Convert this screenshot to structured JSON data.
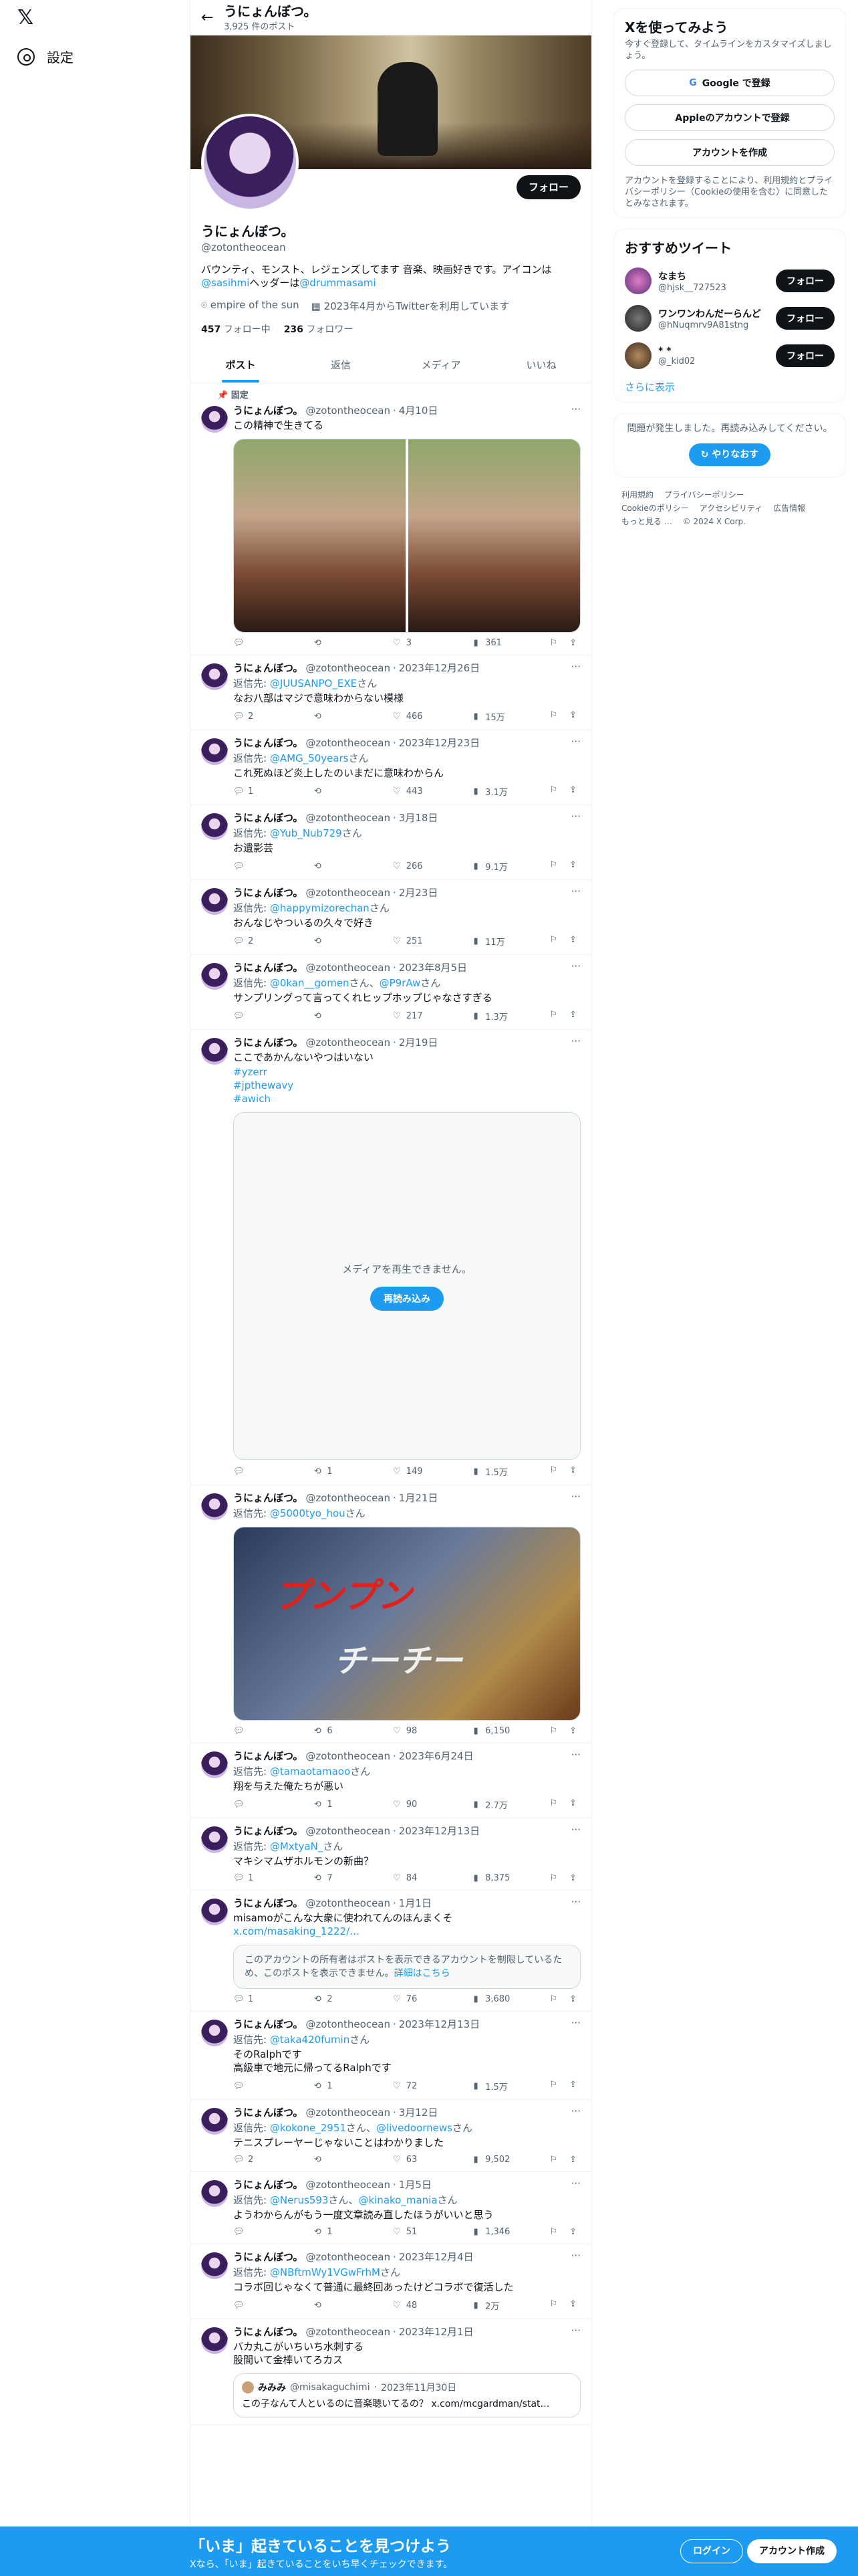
{
  "nav": {
    "settings_label": "設定"
  },
  "header": {
    "title": "うにょんぼつ。",
    "post_count": "3,925 件のポスト"
  },
  "profile": {
    "follow_label": "フォロー",
    "name": "うにょんぼつ。",
    "handle": "@zotontheocean",
    "bio_text": "バウンティ、モンスト、レジェンズしてます 音楽、映画好きです。アイコンは",
    "bio_mention1": "@sasihmi",
    "bio_mid": "ヘッダーは",
    "bio_mention2": "@drummasami",
    "location": "empire of the sun",
    "joined": "2023年4月からTwitterを利用しています",
    "following_count": "457",
    "following_label": "フォロー中",
    "followers_count": "236",
    "followers_label": "フォロワー"
  },
  "tabs": [
    "ポスト",
    "返信",
    "メディア",
    "いいね"
  ],
  "pinned_label": "固定",
  "tweets": [
    {
      "name": "うにょんぼつ。",
      "handle": "@zotontheocean",
      "date": "4月10日",
      "text": "この精神で生きてる",
      "replies": "",
      "retweets": "",
      "likes": "3",
      "views": "361"
    },
    {
      "name": "うにょんぼつ。",
      "handle": "@zotontheocean",
      "date": "2023年12月26日",
      "reply_to": "@JUUSANPO_EXE",
      "text": "なお八部はマジで意味わからない模様",
      "replies": "2",
      "retweets": "",
      "likes": "466",
      "views": "15万"
    },
    {
      "name": "うにょんぼつ。",
      "handle": "@zotontheocean",
      "date": "2023年12月23日",
      "reply_to": "@AMG_50years",
      "text": "これ死ぬほど炎上したのいまだに意味わからん",
      "replies": "1",
      "retweets": "",
      "likes": "443",
      "views": "3.1万"
    },
    {
      "name": "うにょんぼつ。",
      "handle": "@zotontheocean",
      "date": "3月18日",
      "reply_to": "@Yub_Nub729",
      "text": "お遺影芸",
      "replies": "",
      "retweets": "",
      "likes": "266",
      "views": "9.1万"
    },
    {
      "name": "うにょんぼつ。",
      "handle": "@zotontheocean",
      "date": "2月23日",
      "reply_to": "@happymizorechan",
      "text": "おんなじやついるの久々で好き",
      "replies": "2",
      "retweets": "",
      "likes": "251",
      "views": "11万"
    },
    {
      "name": "うにょんぼつ。",
      "handle": "@zotontheocean",
      "date": "2023年8月5日",
      "reply_to": "@0kan__gomen",
      "reply_to2": "@P9rAw",
      "text": "サンプリングって言ってくれヒップホップじゃなさすぎる",
      "replies": "",
      "retweets": "",
      "likes": "217",
      "views": "1.3万"
    },
    {
      "name": "うにょんぼつ。",
      "handle": "@zotontheocean",
      "date": "2月19日",
      "text": "ここであかんないやつはいない",
      "hashtags": "#yzerr\n#jpthewavy\n#awich",
      "video_msg": "メディアを再生できません。",
      "video_btn": "再読み込み",
      "replies": "",
      "retweets": "1",
      "likes": "149",
      "views": "1.5万"
    },
    {
      "name": "うにょんぼつ。",
      "handle": "@zotontheocean",
      "date": "1月21日",
      "reply_to": "@5000tyo_hou",
      "img_text1": "プンプン",
      "img_text2": "チーチー",
      "replies": "",
      "retweets": "6",
      "likes": "98",
      "views": "6,150"
    },
    {
      "name": "うにょんぼつ。",
      "handle": "@zotontheocean",
      "date": "2023年6月24日",
      "reply_to": "@tamaotamaoo",
      "text": "翔を与えた俺たちが悪い",
      "replies": "",
      "retweets": "1",
      "likes": "90",
      "views": "2.7万"
    },
    {
      "name": "うにょんぼつ。",
      "handle": "@zotontheocean",
      "date": "2023年12月13日",
      "reply_to": "@MxtyaN_",
      "text": "マキシマムザホルモンの新曲？",
      "replies": "1",
      "retweets": "7",
      "likes": "84",
      "views": "8,375"
    },
    {
      "name": "うにょんぼつ。",
      "handle": "@zotontheocean",
      "date": "1月1日",
      "text": "misamoがこんな大衆に使われてんのほんまくそ",
      "link": "x.com/masaking_1222/…",
      "notice": "このアカウントの所有者はポストを表示できるアカウントを制限しているため、このポストを表示できません。",
      "notice_link": "詳細はこちら",
      "replies": "1",
      "retweets": "2",
      "likes": "76",
      "views": "3,680"
    },
    {
      "name": "うにょんぼつ。",
      "handle": "@zotontheocean",
      "date": "2023年12月13日",
      "reply_to": "@taka420fumin",
      "text": "そのRalphです\n高級車で地元に帰ってるRalphです",
      "replies": "",
      "retweets": "1",
      "likes": "72",
      "views": "1.5万"
    },
    {
      "name": "うにょんぼつ。",
      "handle": "@zotontheocean",
      "date": "3月12日",
      "reply_to": "@kokone_2951",
      "reply_to2": "@livedoornews",
      "text": "テニスプレーヤーじゃないことはわかりました",
      "replies": "2",
      "retweets": "",
      "likes": "63",
      "views": "9,502"
    },
    {
      "name": "うにょんぼつ。",
      "handle": "@zotontheocean",
      "date": "1月5日",
      "reply_to": "@Nerus593",
      "reply_to2": "@kinako_mania",
      "text": "ようわからんがもう一度文章読み直したほうがいいと思う",
      "replies": "",
      "retweets": "1",
      "likes": "51",
      "views": "1,346"
    },
    {
      "name": "うにょんぼつ。",
      "handle": "@zotontheocean",
      "date": "2023年12月4日",
      "reply_to": "@NBftmWy1VGwFrhM",
      "text": "コラボ回じゃなくて普通に最終回あったけどコラボで復活した",
      "replies": "",
      "retweets": "",
      "likes": "48",
      "views": "2万"
    },
    {
      "name": "うにょんぼつ。",
      "handle": "@zotontheocean",
      "date": "2023年12月1日",
      "text": "バカ丸こがいちいち水刺する\n股間いて金棒いてろカス",
      "quote_name": "みみみ",
      "quote_handle": "@misakaguchimi",
      "quote_date": "2023年11月30日",
      "quote_text": "この子なんて人といるのに音楽聴いてるの？ x.com/mcgardman/stat…"
    }
  ],
  "reply_prefix": "返信先:",
  "reply_suffix": "さん",
  "right": {
    "signup_title": "Xを使ってみよう",
    "signup_sub": "今すぐ登録して、タイムラインをカスタマイズしましょう。",
    "google_btn": "Google で登録",
    "apple_btn": "Appleのアカウントで登録",
    "create_btn": "アカウントを作成",
    "legal_text": "アカウントを登録することにより、利用規約とプライバシーポリシー（Cookieの使用を含む）に同意したとみなされます。",
    "rec_title": "おすすめツイート",
    "recs": [
      {
        "name": "なまち",
        "handle": "@hjsk__727523",
        "btn": "フォロー"
      },
      {
        "name": "ワンワンわんだーらんど",
        "handle": "@hNuqmrv9A81stng",
        "btn": "フォロー"
      },
      {
        "name": "* *",
        "handle": "@_kid02",
        "btn": "フォロー"
      }
    ],
    "show_more": "さらに表示",
    "error_text": "問題が発生しました。再読み込みしてください。",
    "retry_btn": "やりなおす",
    "footer": [
      "利用規約",
      "プライバシーポリシー",
      "Cookieのポリシー",
      "アクセシビリティ",
      "広告情報",
      "もっと見る …",
      "© 2024 X Corp."
    ]
  },
  "bottom": {
    "title": "「いま」起きていることを見つけよう",
    "sub": "Xなら、「いま」起きていることをいち早くチェックできます。",
    "login": "ログイン",
    "signup": "アカウント作成"
  }
}
